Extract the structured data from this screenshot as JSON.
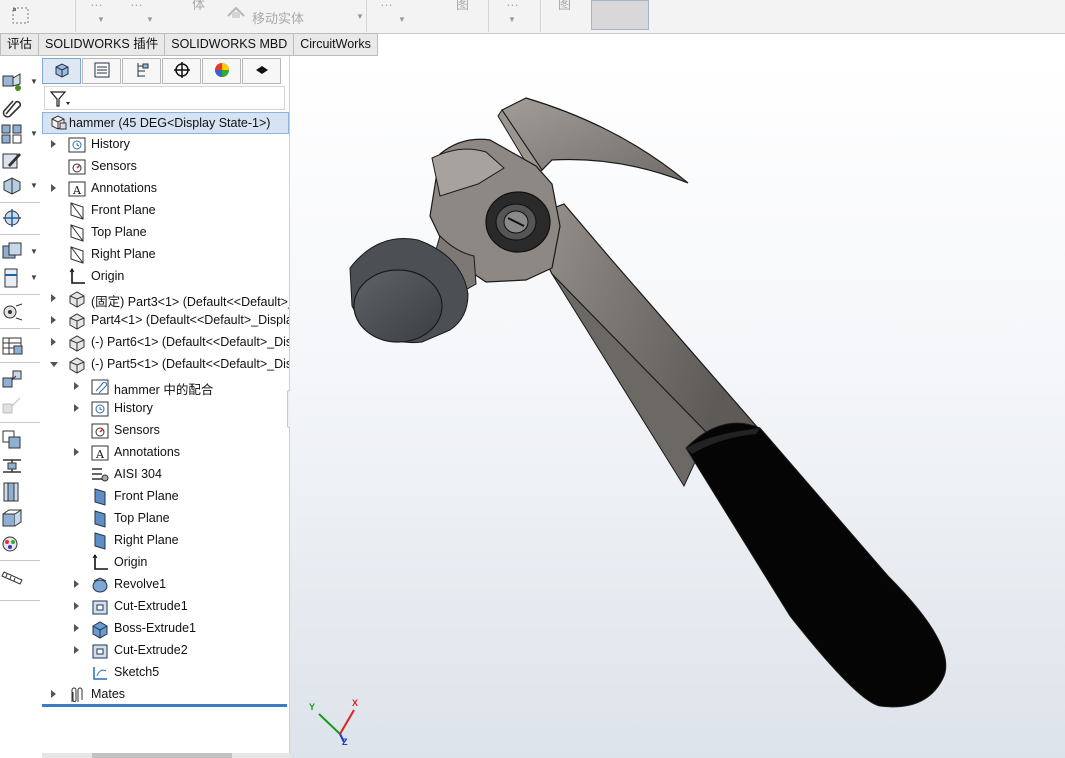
{
  "ribbon": {
    "move_body_label": "移动实体",
    "fragment_a": "…",
    "fragment_b": "体",
    "fragment_c": "图",
    "fragment_d": "图"
  },
  "tabs": [
    {
      "label": "评估"
    },
    {
      "label": "SOLIDWORKS 插件"
    },
    {
      "label": "SOLIDWORKS MBD"
    },
    {
      "label": "CircuitWorks"
    }
  ],
  "feature_tree": {
    "root": "hammer  (45 DEG<Display State-1>)",
    "items": [
      {
        "label": "History"
      },
      {
        "label": "Sensors"
      },
      {
        "label": "Annotations"
      },
      {
        "label": "Front Plane"
      },
      {
        "label": "Top Plane"
      },
      {
        "label": "Right Plane"
      },
      {
        "label": "Origin"
      },
      {
        "label": "(固定) Part3<1> (Default<<Default>_Dis"
      },
      {
        "label": "Part4<1> (Default<<Default>_Display St"
      },
      {
        "label": "(-) Part6<1> (Default<<Default>_Display"
      },
      {
        "label": "(-) Part5<1> (Default<<Default>_Display"
      },
      {
        "label": "hammer 中的配合"
      },
      {
        "label": "History"
      },
      {
        "label": "Sensors"
      },
      {
        "label": "Annotations"
      },
      {
        "label": "AISI 304"
      },
      {
        "label": "Front Plane"
      },
      {
        "label": "Top Plane"
      },
      {
        "label": "Right Plane"
      },
      {
        "label": "Origin"
      },
      {
        "label": "Revolve1"
      },
      {
        "label": "Cut-Extrude1"
      },
      {
        "label": "Boss-Extrude1"
      },
      {
        "label": "Cut-Extrude2"
      },
      {
        "label": "Sketch5"
      },
      {
        "label": "Mates"
      }
    ]
  },
  "triad": {
    "x": "X",
    "y": "Y",
    "z": "Z"
  },
  "colors": {
    "accent": "#3b7dc4",
    "selection_bg": "#d5e3f3",
    "hammer_metal": "#8c8783",
    "hammer_grip": "#050505",
    "hammer_face": "#4a4d50"
  }
}
